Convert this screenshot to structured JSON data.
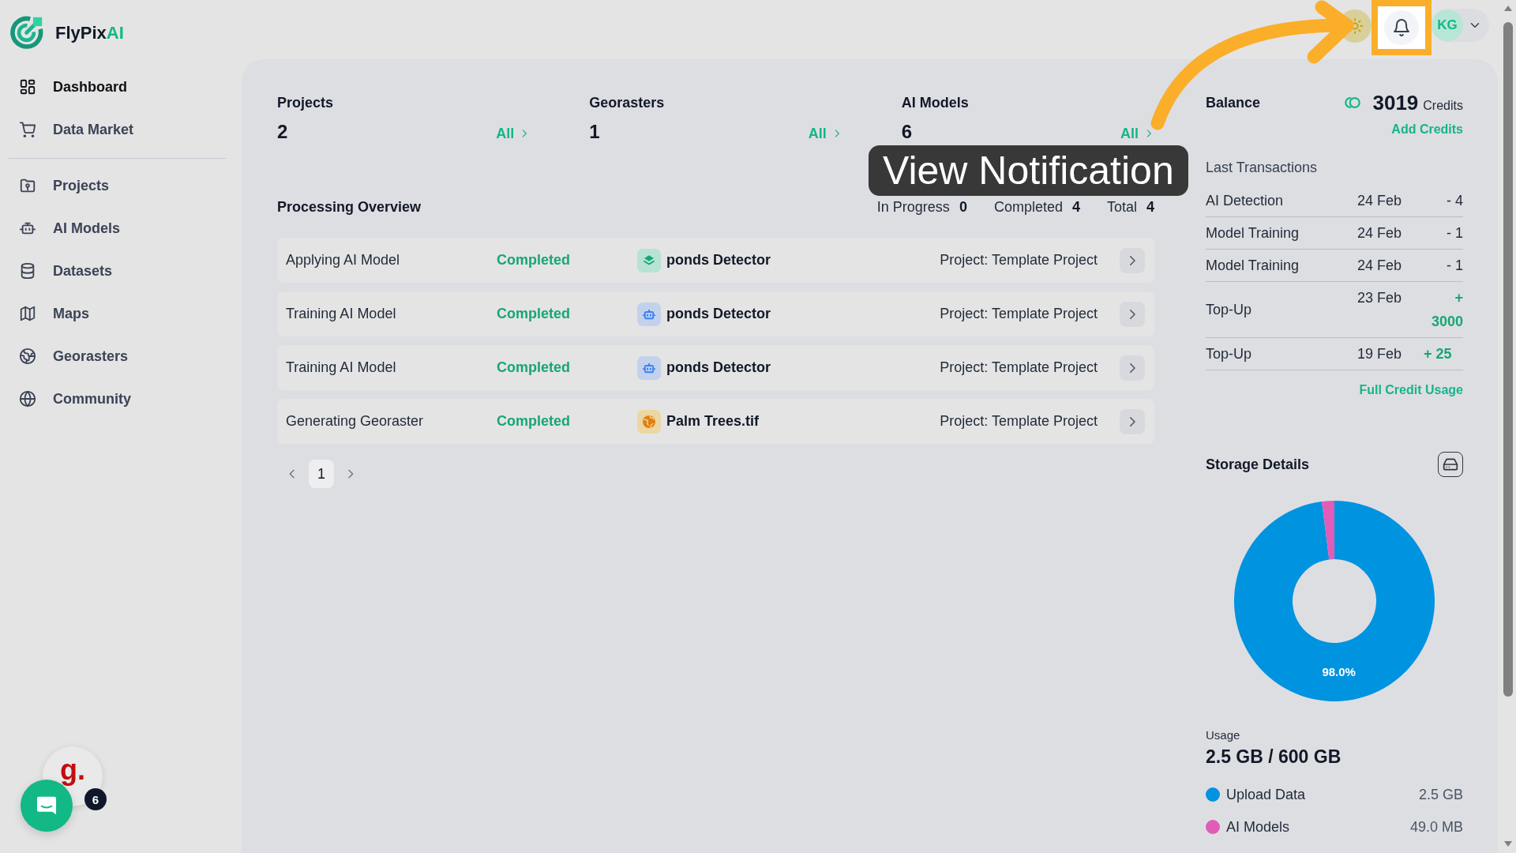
{
  "app": {
    "name": "FlyPix",
    "accent": "AI"
  },
  "sidebar": {
    "groups": [
      {
        "items": [
          {
            "label": "Dashboard",
            "selected": true
          },
          {
            "label": "Data Market",
            "selected": false
          }
        ]
      },
      {
        "items": [
          {
            "label": "Projects",
            "selected": false
          },
          {
            "label": "AI Models",
            "selected": false
          },
          {
            "label": "Datasets",
            "selected": false
          },
          {
            "label": "Maps",
            "selected": false
          },
          {
            "label": "Georasters",
            "selected": false
          },
          {
            "label": "Community",
            "selected": false
          }
        ]
      }
    ]
  },
  "header": {
    "avatar_initials": "KG"
  },
  "stats": [
    {
      "label": "Projects",
      "value": "2",
      "link": "All"
    },
    {
      "label": "Georasters",
      "value": "1",
      "link": "All"
    },
    {
      "label": "AI Models",
      "value": "6",
      "link": "All"
    }
  ],
  "processing": {
    "title": "Processing Overview",
    "counters": [
      {
        "label": "In Progress",
        "value": "0"
      },
      {
        "label": "Completed",
        "value": "4"
      },
      {
        "label": "Total",
        "value": "4"
      }
    ],
    "rows": [
      {
        "task": "Applying AI Model",
        "status": "Completed",
        "kind": "layer",
        "name": "ponds Detector",
        "project": "Project: Template Project"
      },
      {
        "task": "Training AI Model",
        "status": "Completed",
        "kind": "model",
        "name": "ponds Detector",
        "project": "Project: Template Project"
      },
      {
        "task": "Training AI Model",
        "status": "Completed",
        "kind": "model",
        "name": "ponds Detector",
        "project": "Project: Template Project"
      },
      {
        "task": "Generating Georaster",
        "status": "Completed",
        "kind": "georaster",
        "name": "Palm Trees.tif",
        "project": "Project: Template Project"
      }
    ],
    "pagination": {
      "pages": [
        {
          "label": "1",
          "selected": true
        }
      ]
    }
  },
  "balance": {
    "title": "Balance",
    "amount": "3019",
    "unit": "Credits",
    "action": "Add Credits"
  },
  "transactions": {
    "title": "Last Transactions",
    "rows": [
      {
        "name": "AI Detection",
        "date": "24 Feb",
        "amount": "- 4",
        "kind": "debit"
      },
      {
        "name": "Model Training",
        "date": "24 Feb",
        "amount": "- 1",
        "kind": "debit"
      },
      {
        "name": "Model Training",
        "date": "24 Feb",
        "amount": "- 1",
        "kind": "debit"
      },
      {
        "name": "Top-Up",
        "date": "23 Feb",
        "amount": "+ 3000",
        "kind": "credit"
      },
      {
        "name": "Top-Up",
        "date": "19 Feb",
        "amount": "+ 25",
        "kind": "credit"
      }
    ],
    "link": "Full Credit Usage"
  },
  "storage": {
    "title": "Storage Details",
    "chart_data": {
      "type": "donut",
      "categories": [
        "Upload Data",
        "AI Models"
      ],
      "values": [
        98.0,
        2.0
      ],
      "value_labels": [
        "98.0%",
        null
      ]
    },
    "usage_label": "Usage",
    "usage": "2.5 GB / 600 GB",
    "legend": [
      {
        "value": "2.5 GB",
        "color": "#0093e0"
      },
      {
        "value": "49.0 MB",
        "color": "#e05cb8"
      }
    ]
  },
  "widgets": {
    "app_letter": "g.",
    "count": "6"
  },
  "tutorial": {
    "tooltip": "View Notification"
  }
}
